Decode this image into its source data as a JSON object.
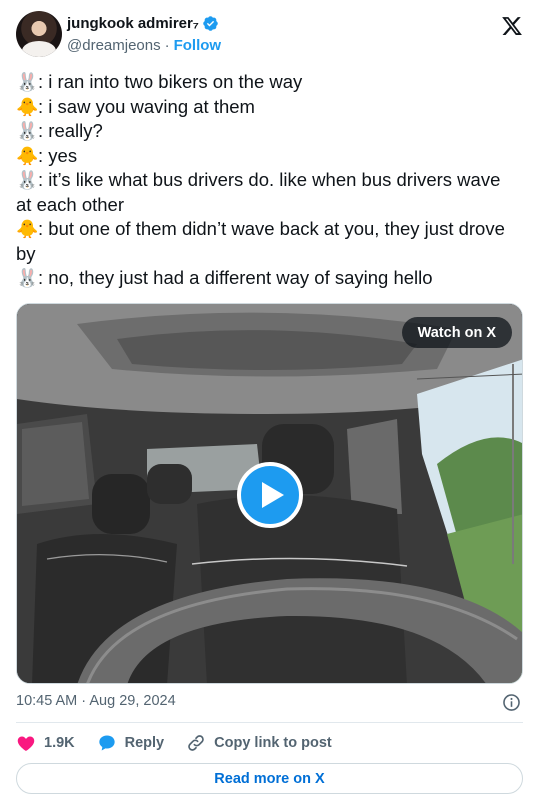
{
  "author": {
    "display_name": "jungkook admirer₇",
    "handle": "@dreamjeons",
    "separator": "·",
    "follow_label": "Follow"
  },
  "icons": {
    "verified": "verified-badge-icon",
    "logo": "x-logo-icon",
    "bunny": "rabbit-face-emoji",
    "chick": "baby-chick-emoji",
    "info": "info-icon",
    "like": "heart-icon",
    "reply": "speech-bubble-icon",
    "copy": "link-icon"
  },
  "tweet": {
    "lines": [
      {
        "emoji": "🐰",
        "text": ": i ran into two bikers on the way"
      },
      {
        "emoji": "🐥",
        "text": ": i saw you waving at them"
      },
      {
        "emoji": "🐰",
        "text": ": really?"
      },
      {
        "emoji": "🐥",
        "text": ": yes"
      },
      {
        "emoji": "🐰",
        "text": ": it’s like what bus drivers do. like when bus drivers wave at each other"
      },
      {
        "emoji": "🐥",
        "text": ": but one of them didn’t wave back at you, they just drove by"
      },
      {
        "emoji": "🐰",
        "text": ": no, they just had a different way of saying hello"
      }
    ]
  },
  "media": {
    "watch_label": "Watch on X"
  },
  "meta": {
    "time": "10:45 AM",
    "separator": "·",
    "date": "Aug 29, 2024"
  },
  "actions": {
    "likes": "1.9K",
    "reply_label": "Reply",
    "copy_label": "Copy link to post"
  },
  "read_more_label": "Read more on X",
  "colors": {
    "accent": "#1d9bf0",
    "like": "#f91880",
    "link": "#006fd6",
    "muted": "#536471"
  }
}
